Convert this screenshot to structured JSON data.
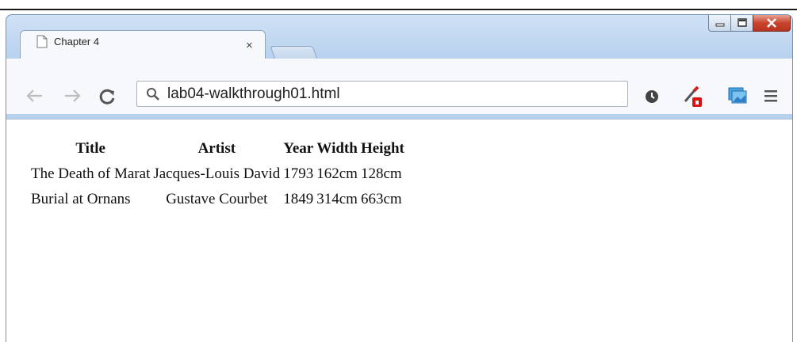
{
  "browser": {
    "tab_title": "Chapter 4",
    "tab_close": "×",
    "url": "lab04-walkthrough01.html",
    "window_controls": {
      "minimize": "—",
      "maximize": "□",
      "close": "X"
    }
  },
  "icons": [
    "page-icon",
    "back-arrow-icon",
    "forward-arrow-icon",
    "reload-icon",
    "search-icon",
    "clock-icon",
    "eyedropper-icon",
    "picture-icon",
    "menu-icon"
  ],
  "table": {
    "headers": [
      "Title",
      "Artist",
      "Year",
      "Width",
      "Height"
    ],
    "rows": [
      [
        "The Death of Marat",
        "Jacques-Louis David",
        "1793",
        "162cm",
        "128cm"
      ],
      [
        "Burial at Ornans",
        "Gustave Courbet",
        "1849",
        "314cm",
        "663cm"
      ]
    ]
  }
}
